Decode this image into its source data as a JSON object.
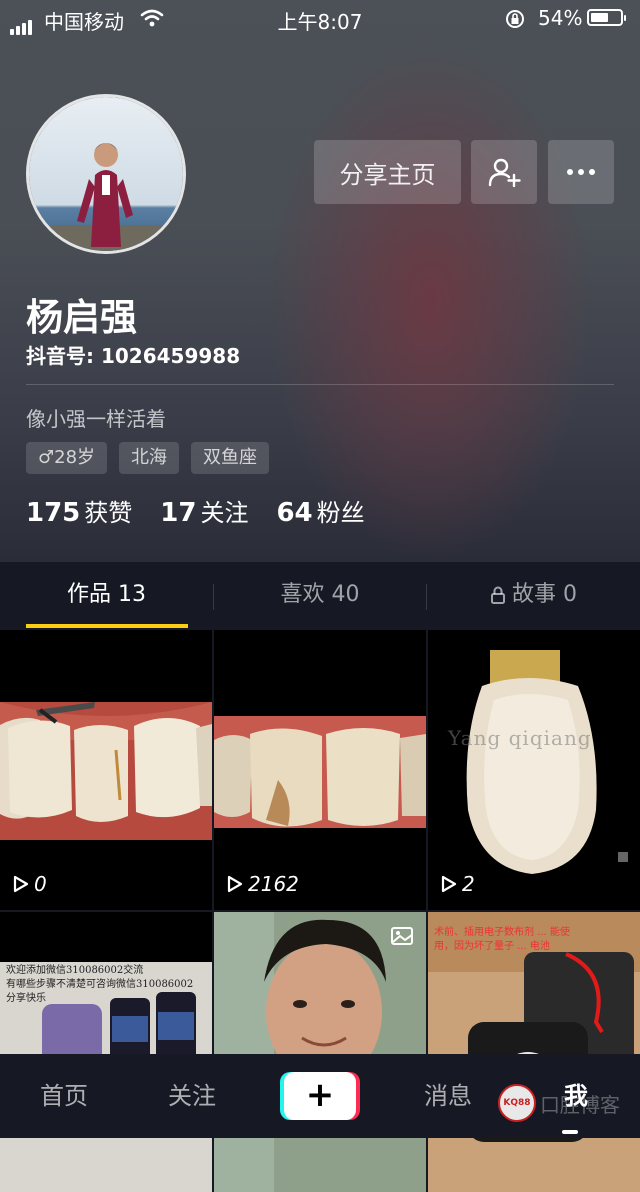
{
  "status_bar": {
    "carrier": "中国移动",
    "time": "上午8:07",
    "battery_percent": "54%",
    "battery_level": 0.54
  },
  "profile": {
    "name": "杨启强",
    "douyin_id": "抖音号: 1026459988",
    "bio": "像小强一样活着",
    "tags": [
      "♂28岁",
      "北海",
      "双鱼座"
    ],
    "stats": [
      {
        "num": "175",
        "label": "获赞"
      },
      {
        "num": "17",
        "label": "关注"
      },
      {
        "num": "64",
        "label": "粉丝"
      }
    ]
  },
  "actions": {
    "share_label": "分享主页",
    "add_friend_icon": "add-user-icon",
    "more_icon": "more-dots-icon"
  },
  "tabs": [
    {
      "label": "作品 13",
      "active": true
    },
    {
      "label": "喜欢 40",
      "active": false
    },
    {
      "label": "故事 0",
      "active": false,
      "icon": "lock-icon"
    }
  ],
  "videos": [
    {
      "plays": "0"
    },
    {
      "plays": "2162"
    },
    {
      "plays": "2"
    },
    {
      "overlay_text": [
        "欢迎添加微信310086002交流",
        "有哪些步骤不清楚可咨询微信310086002",
        "分享快乐"
      ]
    },
    {
      "icon": "image-icon"
    },
    {
      "overlay_text": [
        "术前、插用电子数布剂 ... 能使",
        "用，因为坏了量子 ... 电池"
      ]
    }
  ],
  "tooth_watermark": "Yang qiqiang",
  "bottom_nav": {
    "home": "首页",
    "follow": "关注",
    "plus": "+",
    "messages": "消息",
    "me": "我"
  },
  "site_watermark": {
    "badge": "KQ88",
    "text": "口腔博客"
  },
  "colors": {
    "accent": "#face15",
    "background": "#161823",
    "brand_cyan": "#25f4ee",
    "brand_red": "#fe2c55"
  }
}
